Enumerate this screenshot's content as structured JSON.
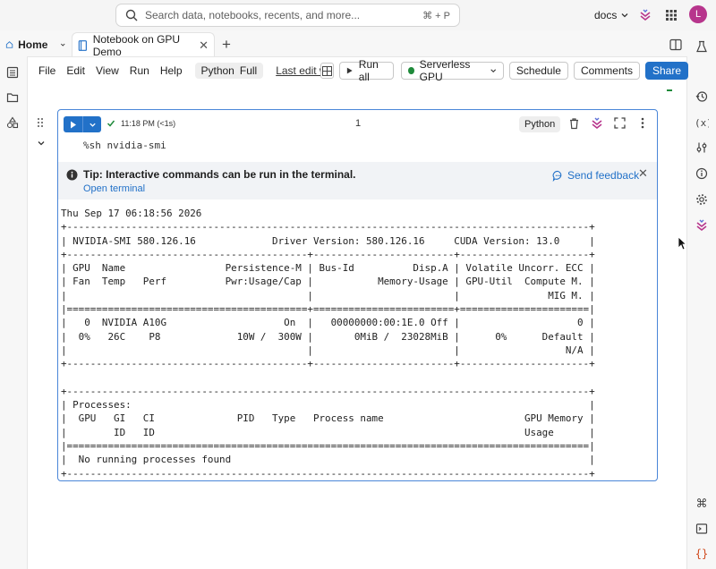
{
  "topbar": {
    "search_placeholder": "Search data, notebooks, recents, and more...",
    "search_shortcut": "⌘ + P",
    "workspace": "docs",
    "avatar_initial": "L"
  },
  "tabs": {
    "home_label": "Home",
    "notebook_label": "Notebook on GPU Demo"
  },
  "toolbar": {
    "menus": [
      "File",
      "Edit",
      "View",
      "Run",
      "Help"
    ],
    "lang_python": "Python",
    "lang_full": "Full",
    "last_edit": "Last edit was",
    "run_all": "Run all",
    "compute": "Serverless GPU",
    "schedule": "Schedule",
    "comments": "Comments",
    "share": "Share"
  },
  "cell": {
    "exec_time": "11:18 PM (<1s)",
    "number": "1",
    "language": "Python",
    "code": "%sh nvidia-smi",
    "tip_title": "Tip: Interactive commands can be run in the terminal.",
    "tip_link": "Open terminal",
    "feedback": "Send feedback",
    "output": "Thu Sep 17 06:18:56 2026\n+-----------------------------------------------------------------------------------------+\n| NVIDIA-SMI 580.126.16             Driver Version: 580.126.16     CUDA Version: 13.0     |\n+-----------------------------------------+------------------------+----------------------+\n| GPU  Name                 Persistence-M | Bus-Id          Disp.A | Volatile Uncorr. ECC |\n| Fan  Temp   Perf          Pwr:Usage/Cap |           Memory-Usage | GPU-Util  Compute M. |\n|                                         |                        |               MIG M. |\n|=========================================+========================+======================|\n|   0  NVIDIA A10G                    On  |   00000000:00:1E.0 Off |                    0 |\n|  0%   26C    P8             10W /  300W |       0MiB /  23028MiB |      0%      Default |\n|                                         |                        |                  N/A |\n+-----------------------------------------+------------------------+----------------------+\n\n+-----------------------------------------------------------------------------------------+\n| Processes:                                                                              |\n|  GPU   GI   CI              PID   Type   Process name                        GPU Memory |\n|        ID   ID                                                               Usage      |\n|=========================================================================================|\n|  No running processes found                                                             |\n+-----------------------------------------------------------------------------------------+"
  },
  "colors": {
    "accent": "#2271c8",
    "running": "#1f8a3b",
    "brand": "#b7358c"
  }
}
